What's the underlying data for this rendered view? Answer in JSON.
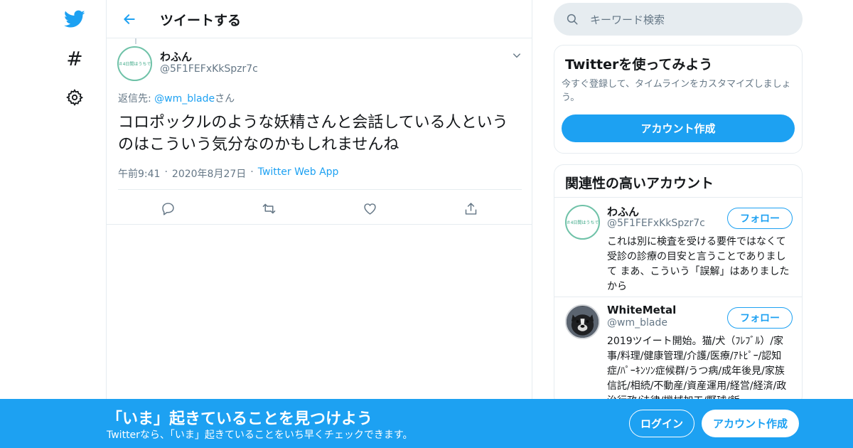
{
  "colors": {
    "accent": "#1da1f2",
    "muted": "#657786",
    "border": "#e6ecf0"
  },
  "nav": {
    "icons": [
      "twitter-logo-icon",
      "hashtag-icon",
      "gear-icon"
    ],
    "hashtag_glyph": "#"
  },
  "header": {
    "title": "ツイートする",
    "back_icon": "arrow-left-icon"
  },
  "tweet": {
    "avatar_text": "＃4日間はうちで",
    "name": "わふん",
    "handle": "@5F1FEFxKkSpzr7c",
    "reply_prefix": "返信先: ",
    "reply_to": "@wm_blade",
    "reply_suffix": "さん",
    "body": "コロポックルのような妖精さんと会話している人というのはこういう気分なのかもしれませんね",
    "time": "午前9:41",
    "date": "2020年8月27日",
    "app": "Twitter Web App",
    "sep": "·"
  },
  "search": {
    "placeholder": "キーワード検索"
  },
  "signup_card": {
    "title": "Twitterを使ってみよう",
    "desc": "今すぐ登録して、タイムラインをカスタマイズしましょう。",
    "button": "アカウント作成"
  },
  "related": {
    "title": "関連性の高いアカウント",
    "follow_label": "フォロー",
    "accounts": [
      {
        "name": "わふん",
        "handle": "@5F1FEFxKkSpzr7c",
        "avatar_text": "＃4日間はうちで",
        "bio": "これは別に検査を受ける要件ではなくて 受診の診療の目安と言うことでありまして まあ、こういう「誤解」はありましたから"
      },
      {
        "name": "WhiteMetal",
        "handle": "@wm_blade",
        "bio": "2019ツイート開始。猫/犬（ﾌﾚﾌﾞﾙ）/家事/料理/健康管理/介護/医療/ｱﾄﾋﾟｰ/認知症/ﾊﾟｰｷﾝｿﾝ症候群/うつ病/成年後見/家族信託/相続/不動産/資産運用/経営/経済/政治行政/法律/機械加工/野球/飯"
      }
    ]
  },
  "banner": {
    "title": "「いま」起きていることを見つけよう",
    "subtitle": "Twitterなら、「いま」起きていることをいち早くチェックできます。",
    "login": "ログイン",
    "signup": "アカウント作成"
  }
}
